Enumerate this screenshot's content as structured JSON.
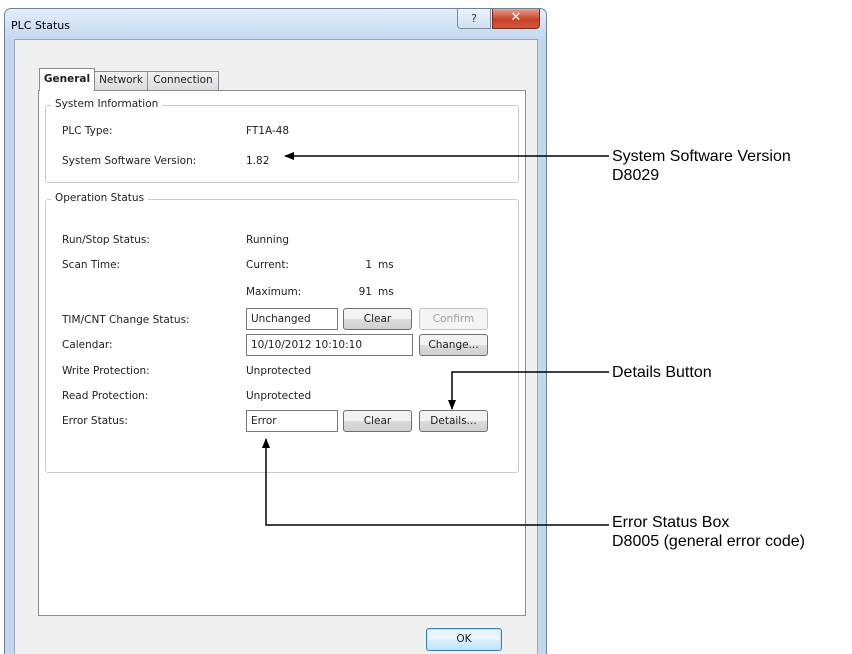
{
  "window": {
    "title": "PLC Status"
  },
  "titlebar_buttons": {
    "help": "?",
    "close": "✕"
  },
  "tabs": [
    {
      "label": "General"
    },
    {
      "label": "Network"
    },
    {
      "label": "Connection"
    }
  ],
  "system_info": {
    "group_title": "System Information",
    "plc_type_label": "PLC Type:",
    "plc_type_value": "FT1A-48",
    "sw_version_label": "System Software Version:",
    "sw_version_value": "1.82"
  },
  "operation_status": {
    "group_title": "Operation Status",
    "run_stop_label": "Run/Stop Status:",
    "run_stop_value": "Running",
    "scan_time_label": "Scan Time:",
    "current_label": "Current:",
    "current_value": "1",
    "current_unit": "ms",
    "maximum_label": "Maximum:",
    "maximum_value": "91",
    "maximum_unit": "ms",
    "timcnt_label": "TIM/CNT Change Status:",
    "timcnt_value": "Unchanged",
    "timcnt_clear_button": "Clear",
    "timcnt_confirm_button": "Confirm",
    "calendar_label": "Calendar:",
    "calendar_value": "10/10/2012 10:10:10",
    "calendar_change_button": "Change...",
    "write_protection_label": "Write Protection:",
    "write_protection_value": "Unprotected",
    "read_protection_label": "Read Protection:",
    "read_protection_value": "Unprotected",
    "error_status_label": "Error Status:",
    "error_status_value": "Error",
    "error_clear_button": "Clear",
    "details_button": "Details..."
  },
  "ok_button": "OK",
  "callouts": {
    "sw_version_line1": "System Software Version",
    "sw_version_line2": "D8029",
    "details_button": "Details Button",
    "error_box_line1": "Error Status Box",
    "error_box_line2": "D8005 (general error code)"
  }
}
